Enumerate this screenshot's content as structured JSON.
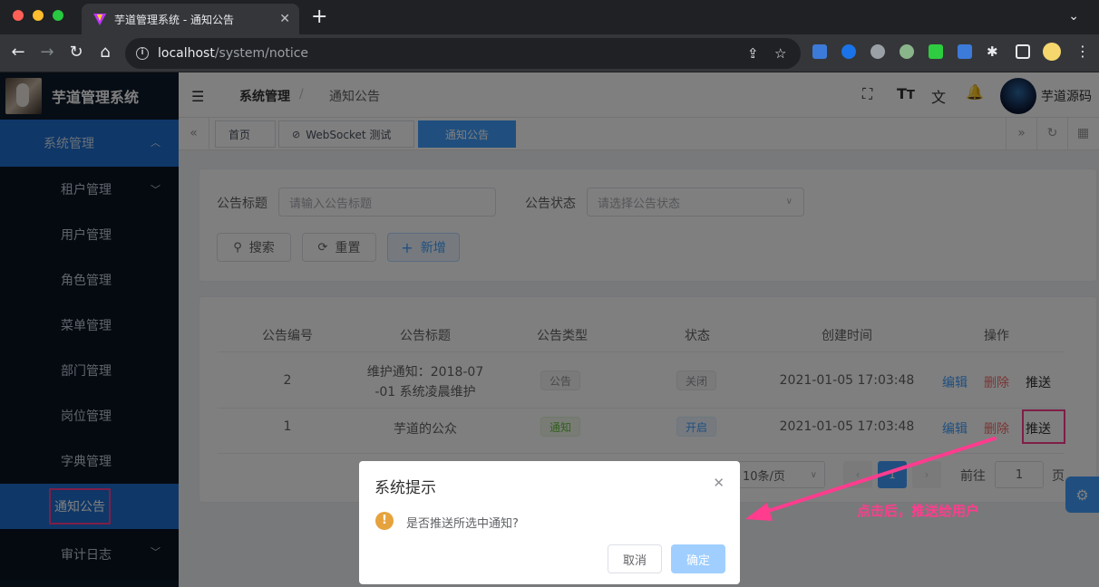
{
  "browser": {
    "tab_title": "芋道管理系统 - 通知公告",
    "url_host": "localhost",
    "url_path": "/system/notice"
  },
  "sidebar": {
    "app_title": "芋道管理系统",
    "parent": "系统管理",
    "items": [
      {
        "label": "租户管理",
        "has_children": true
      },
      {
        "label": "用户管理"
      },
      {
        "label": "角色管理"
      },
      {
        "label": "菜单管理"
      },
      {
        "label": "部门管理"
      },
      {
        "label": "岗位管理"
      },
      {
        "label": "字典管理"
      },
      {
        "label": "通知公告",
        "active": true
      },
      {
        "label": "审计日志",
        "has_children": true
      }
    ]
  },
  "navbar": {
    "breadcrumb": [
      "系统管理",
      "通知公告"
    ],
    "separator": "/",
    "user_name": "芋道源码"
  },
  "tags": [
    "首页",
    "WebSocket 测试",
    "通知公告"
  ],
  "search": {
    "title_label": "公告标题",
    "title_placeholder": "请输入公告标题",
    "status_label": "公告状态",
    "status_placeholder": "请选择公告状态",
    "search_btn": "搜索",
    "reset_btn": "重置",
    "add_btn": "新增"
  },
  "table": {
    "headers": [
      "公告编号",
      "公告标题",
      "公告类型",
      "状态",
      "创建时间",
      "操作"
    ],
    "rows": [
      {
        "id": "2",
        "title_line1": "维护通知：2018-07",
        "title_line2": "-01 系统凌晨维护",
        "type": "公告",
        "status": "关闭",
        "created": "2021-01-05 17:03:48"
      },
      {
        "id": "1",
        "title_line1": "芋道的公众",
        "title_line2": "",
        "type": "通知",
        "status": "开启",
        "created": "2021-01-05 17:03:48"
      }
    ],
    "actions": {
      "edit": "编辑",
      "delete": "删除",
      "push": "推送"
    }
  },
  "pagination": {
    "page_size": "10条/页",
    "current": "1",
    "goto_label": "前往",
    "goto_value": "1",
    "page_suffix": "页"
  },
  "dialog": {
    "title": "系统提示",
    "message": "是否推送所选中通知?",
    "cancel": "取消",
    "confirm": "确定"
  },
  "annotation": "点击后，推送给用户",
  "colors": {
    "primary": "#409eff",
    "highlight": "#ff3c8e",
    "sidebar_bg": "#0f1a2b"
  }
}
